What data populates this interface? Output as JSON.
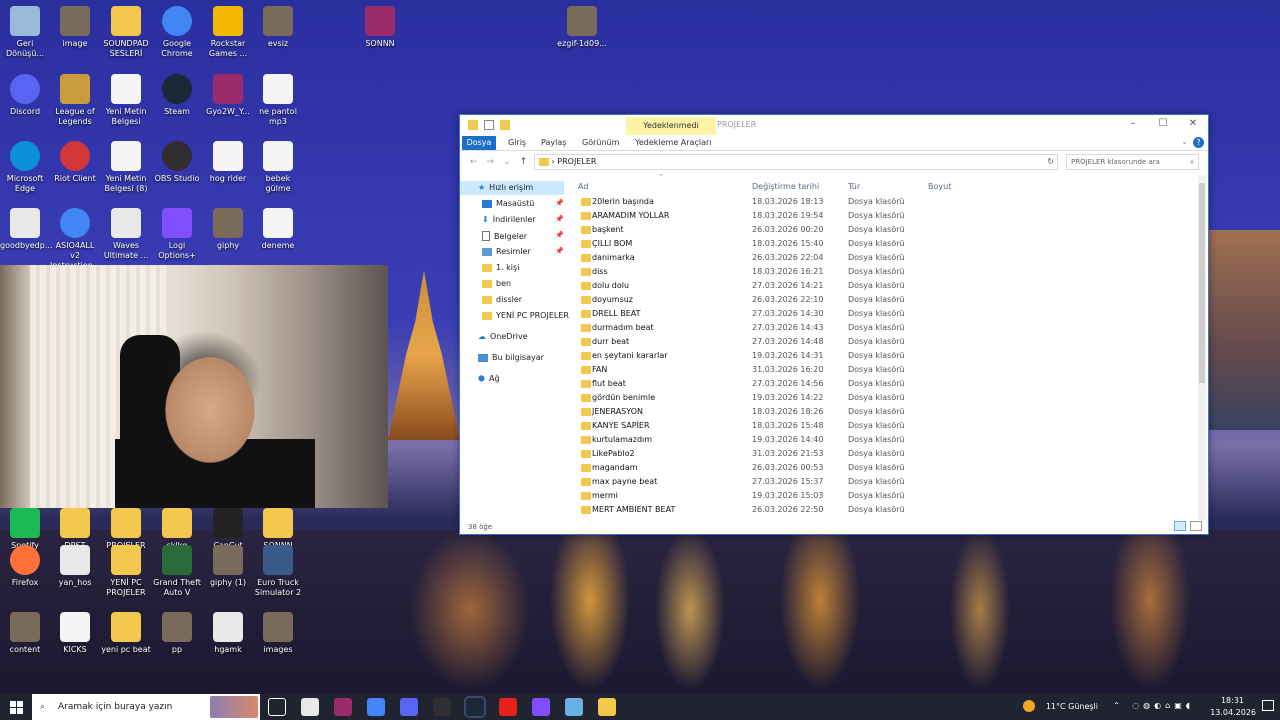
{
  "desktop": {
    "icons": [
      {
        "label": "Geri Dönüşü...",
        "icon": "recycle-bin-icon"
      },
      {
        "label": "image",
        "icon": "image-icon"
      },
      {
        "label": "SOUNDPAD SESLERİ",
        "icon": "folder-icon"
      },
      {
        "label": "Google Chrome",
        "icon": "chrome-icon"
      },
      {
        "label": "Rockstar Games ...",
        "icon": "rockstar-icon"
      },
      {
        "label": "evsiz",
        "icon": "image-icon"
      },
      {
        "label": "SONNN",
        "icon": "winrar-icon"
      },
      {
        "label": "ezgif-1d09...",
        "icon": "image-icon"
      },
      {
        "label": "Discord",
        "icon": "discord-icon"
      },
      {
        "label": "League of Legends",
        "icon": "league-icon"
      },
      {
        "label": "Yeni Metin Belgesi",
        "icon": "text-file-icon"
      },
      {
        "label": "Steam",
        "icon": "steam-icon"
      },
      {
        "label": "Gyo2W_Y...",
        "icon": "winrar-icon"
      },
      {
        "label": "ne pantol mp3",
        "icon": "mp3-icon"
      },
      {
        "label": "Microsoft Edge",
        "icon": "edge-icon"
      },
      {
        "label": "Riot Client",
        "icon": "riot-icon"
      },
      {
        "label": "Yeni Metin Belgesi (8)",
        "icon": "text-file-icon"
      },
      {
        "label": "OBS Studio",
        "icon": "obs-icon"
      },
      {
        "label": "hog rider",
        "icon": "wav-icon"
      },
      {
        "label": "bebek gülme",
        "icon": "wav-icon"
      },
      {
        "label": "goodbyedp...",
        "icon": "file-icon"
      },
      {
        "label": "ASIO4ALL v2 Instruction...",
        "icon": "chrome-icon"
      },
      {
        "label": "Waves Ultimate ...",
        "icon": "file-icon"
      },
      {
        "label": "Logi Options+",
        "icon": "logi-icon"
      },
      {
        "label": "giphy",
        "icon": "image-icon"
      },
      {
        "label": "deneme",
        "icon": "mp3-icon"
      },
      {
        "label": "Spotify",
        "icon": "spotify-icon"
      },
      {
        "label": "DPST",
        "icon": "folder-icon"
      },
      {
        "label": "PROJELER",
        "icon": "folder-icon"
      },
      {
        "label": "sklkq",
        "icon": "folder-icon"
      },
      {
        "label": "CapCut",
        "icon": "capcut-icon"
      },
      {
        "label": "SONNN",
        "icon": "folder-icon"
      },
      {
        "label": "Firefox",
        "icon": "firefox-icon"
      },
      {
        "label": "yan_hos",
        "icon": "file-icon"
      },
      {
        "label": "YENİ PC PROJELER",
        "icon": "folder-icon"
      },
      {
        "label": "Grand Theft Auto V",
        "icon": "gta-icon"
      },
      {
        "label": "giphy (1)",
        "icon": "image-icon"
      },
      {
        "label": "Euro Truck Simulator 2",
        "icon": "ets2-icon"
      },
      {
        "label": "content",
        "icon": "image-icon"
      },
      {
        "label": "KICKS",
        "icon": "wav-icon"
      },
      {
        "label": "yeni pc beat",
        "icon": "folder-icon"
      },
      {
        "label": "pp",
        "icon": "image-icon"
      },
      {
        "label": "hgamk",
        "icon": "file-icon"
      },
      {
        "label": "images",
        "icon": "image-icon"
      }
    ]
  },
  "explorer": {
    "title": "PROJELER",
    "context_tab": "Yedeklenmedi",
    "ribbon_tabs": [
      "Dosya",
      "Giriş",
      "Paylaş",
      "Görünüm",
      "Yedekleme Araçları"
    ],
    "address": "PROJELER",
    "search_placeholder": "PROJELER klasorunde ara",
    "columns": {
      "name": "Ad",
      "date": "Değiştirme tarihi",
      "type": "Tür",
      "size": "Boyut"
    },
    "nav": [
      {
        "label": "Hızlı erişim",
        "icon": "star-icon"
      },
      {
        "label": "Masaüstü",
        "icon": "desktop-icon"
      },
      {
        "label": "İndirilenler",
        "icon": "download-icon"
      },
      {
        "label": "Belgeler",
        "icon": "documents-icon"
      },
      {
        "label": "Resimler",
        "icon": "pictures-icon"
      },
      {
        "label": "1. kişi",
        "icon": "folder-icon"
      },
      {
        "label": "ben",
        "icon": "folder-icon"
      },
      {
        "label": "dissler",
        "icon": "folder-icon"
      },
      {
        "label": "YENİ PC PROJELER",
        "icon": "folder-icon"
      },
      {
        "label": "OneDrive",
        "icon": "cloud-icon"
      },
      {
        "label": "Bu bilgisayar",
        "icon": "computer-icon"
      },
      {
        "label": "Ağ",
        "icon": "network-icon"
      }
    ],
    "files": [
      {
        "name": "20lerin başında",
        "date": "18.03.2026 18:13",
        "type": "Dosya klasörü"
      },
      {
        "name": "ARAMADIM YOLLAR",
        "date": "18.03.2026 19:54",
        "type": "Dosya klasörü"
      },
      {
        "name": "başkent",
        "date": "26.03.2026 00:20",
        "type": "Dosya klasörü"
      },
      {
        "name": "ÇILLI BOM",
        "date": "18.03.2026 15:40",
        "type": "Dosya klasörü"
      },
      {
        "name": "danimarka",
        "date": "26.03.2026 22:04",
        "type": "Dosya klasörü"
      },
      {
        "name": "diss",
        "date": "18.03.2026 16:21",
        "type": "Dosya klasörü"
      },
      {
        "name": "dolu dolu",
        "date": "27.03.2026 14:21",
        "type": "Dosya klasörü"
      },
      {
        "name": "doyumsuz",
        "date": "26.03.2026 22:10",
        "type": "Dosya klasörü"
      },
      {
        "name": "DRELL BEAT",
        "date": "27.03.2026 14:30",
        "type": "Dosya klasörü"
      },
      {
        "name": "durmadım beat",
        "date": "27.03.2026 14:43",
        "type": "Dosya klasörü"
      },
      {
        "name": "durr beat",
        "date": "27.03.2026 14:48",
        "type": "Dosya klasörü"
      },
      {
        "name": "en şeytani kararlar",
        "date": "19.03.2026 14:31",
        "type": "Dosya klasörü"
      },
      {
        "name": "FAN",
        "date": "31.03.2026 16:20",
        "type": "Dosya klasörü"
      },
      {
        "name": "flut beat",
        "date": "27.03.2026 14:56",
        "type": "Dosya klasörü"
      },
      {
        "name": "gördün benimle",
        "date": "19.03.2026 14:22",
        "type": "Dosya klasörü"
      },
      {
        "name": "JENERASYON",
        "date": "18.03.2026 18:26",
        "type": "Dosya klasörü"
      },
      {
        "name": "KANYE SAPİER",
        "date": "18.03.2026 15:48",
        "type": "Dosya klasörü"
      },
      {
        "name": "kurtulamazdım",
        "date": "19.03.2026 14:40",
        "type": "Dosya klasörü"
      },
      {
        "name": "LikePablo2",
        "date": "31.03.2026 21:53",
        "type": "Dosya klasörü"
      },
      {
        "name": "magandam",
        "date": "26.03.2026 00:53",
        "type": "Dosya klasörü"
      },
      {
        "name": "max payne beat",
        "date": "27.03.2026 15:37",
        "type": "Dosya klasörü"
      },
      {
        "name": "mermi",
        "date": "19.03.2026 15:03",
        "type": "Dosya klasörü"
      },
      {
        "name": "MERT AMBIENT BEAT",
        "date": "26.03.2026 22:50",
        "type": "Dosya klasörü"
      }
    ],
    "status": "38 öğe"
  },
  "taskbar": {
    "search_placeholder": "Aramak için buraya yazın",
    "weather": "11°C Güneşli",
    "time": "18:31",
    "date": "13.04.2026",
    "apps": [
      "task-view-icon",
      "file-icon",
      "winrar-icon",
      "chrome-icon",
      "discord-icon",
      "obs-icon",
      "steam-icon",
      "youtube-icon",
      "logi-icon",
      "notepad-icon",
      "folder-icon"
    ]
  }
}
